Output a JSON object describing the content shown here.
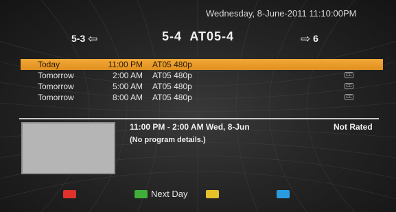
{
  "header": {
    "datetime": "Wednesday, 8-June-2011 11:10:00PM"
  },
  "channel": {
    "prev": "5-3",
    "current": "5-4  AT05-4",
    "next": "6"
  },
  "schedule": [
    {
      "day": "Today",
      "time": "11:00 PM",
      "program": "AT05 480p",
      "selected": true,
      "cc": false
    },
    {
      "day": "Tomorrow",
      "time": "2:00 AM",
      "program": "AT05 480p",
      "selected": false,
      "cc": true,
      "cc_text": "CC"
    },
    {
      "day": "Tomorrow",
      "time": "5:00 AM",
      "program": "AT05 480p",
      "selected": false,
      "cc": true,
      "cc_text": "CC"
    },
    {
      "day": "Tomorrow",
      "time": "8:00 AM",
      "program": "AT05 480p",
      "selected": false,
      "cc": true,
      "cc_text": "CC"
    }
  ],
  "details": {
    "time_range": "11:00 PM - 2:00 AM Wed, 8-Jun",
    "rating": "Not Rated",
    "description": "(No program details.)"
  },
  "color_keys": {
    "red": {
      "color": "#e0312c",
      "label": ""
    },
    "green": {
      "color": "#3fae3a",
      "label": "Next Day"
    },
    "yellow": {
      "color": "#e6c22a",
      "label": ""
    },
    "blue": {
      "color": "#2b9be0",
      "label": ""
    }
  },
  "icons": {
    "prev_arrow": "arrow-left-icon",
    "next_arrow": "arrow-right-icon",
    "cc": "closed-caption-icon"
  }
}
